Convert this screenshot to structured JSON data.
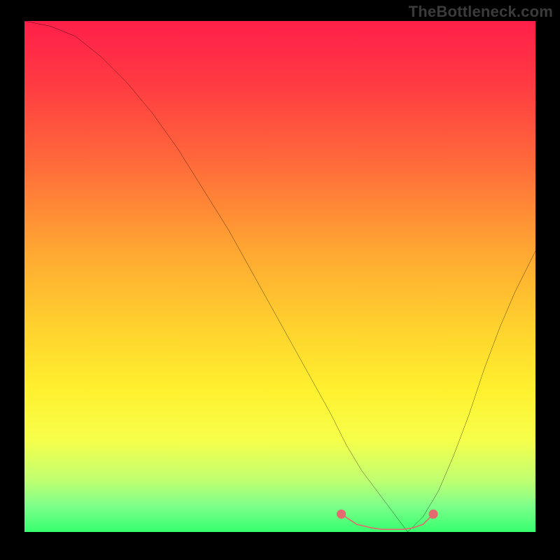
{
  "watermark": "TheBottleneck.com",
  "chart_data": {
    "type": "line",
    "title": "",
    "xlabel": "",
    "ylabel": "",
    "xlim": [
      0,
      100
    ],
    "ylim": [
      0,
      100
    ],
    "gradient_stops": [
      {
        "pct": 0,
        "color": "#ff1f4a"
      },
      {
        "pct": 12,
        "color": "#ff3a42"
      },
      {
        "pct": 28,
        "color": "#ff6b3a"
      },
      {
        "pct": 45,
        "color": "#ffa732"
      },
      {
        "pct": 60,
        "color": "#ffd22e"
      },
      {
        "pct": 72,
        "color": "#fff02e"
      },
      {
        "pct": 82,
        "color": "#f6ff4a"
      },
      {
        "pct": 90,
        "color": "#bfff72"
      },
      {
        "pct": 95,
        "color": "#7cff8a"
      },
      {
        "pct": 100,
        "color": "#37ff6e"
      }
    ],
    "series": [
      {
        "name": "left-curve",
        "x": [
          0,
          5,
          10,
          15,
          20,
          25,
          30,
          35,
          40,
          45,
          50,
          55,
          60,
          63,
          66,
          69,
          72,
          75
        ],
        "y": [
          100,
          99,
          97,
          93,
          88,
          82,
          75,
          67,
          59,
          50,
          41,
          32,
          23,
          17,
          12,
          8,
          4,
          0
        ]
      },
      {
        "name": "right-curve",
        "x": [
          75,
          78,
          81,
          84,
          87,
          90,
          93,
          96,
          100
        ],
        "y": [
          0,
          3,
          8,
          15,
          23,
          32,
          40,
          47,
          55
        ]
      },
      {
        "name": "floor-highlight",
        "x": [
          62,
          65,
          68,
          70,
          72,
          74,
          76,
          78,
          80
        ],
        "y": [
          3.5,
          1.5,
          0.8,
          0.5,
          0.5,
          0.5,
          0.8,
          1.5,
          3.5
        ]
      }
    ],
    "highlight_color": "#e46a6f",
    "curve_color": "#000000"
  }
}
